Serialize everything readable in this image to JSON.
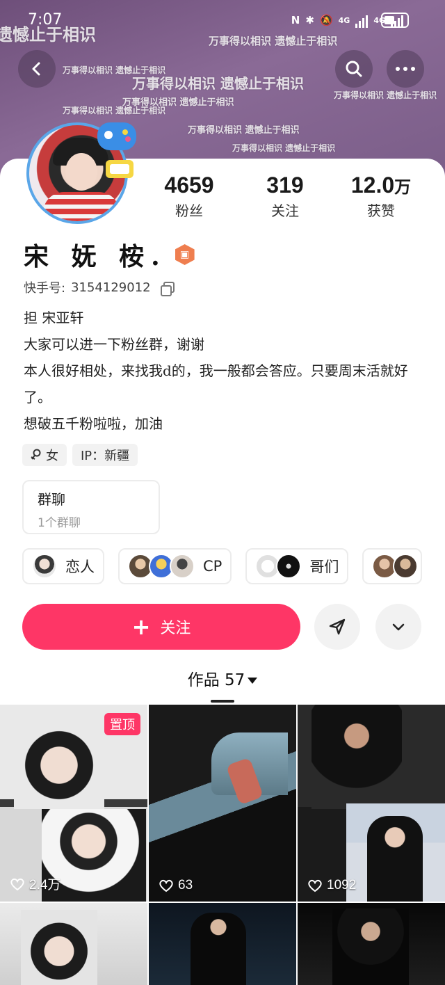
{
  "status_bar": {
    "time": "7:07",
    "network_labels": [
      "4G",
      "4G"
    ]
  },
  "banner": {
    "watermark_lines": [
      "万事得以相识 遗憾止于相识",
      "遗憾止于相识",
      "万事得以相识 遗憾止于相识",
      "万事得以相识 遗憾止于相识",
      "万事得以相识 遗憾止于相识",
      "万事得以相识 遗憾止于相识",
      "万事得以相识 遗憾止于相识",
      "万事得以相识 遗憾止于相识",
      "万事得以相识 遗憾止于相识"
    ]
  },
  "stats": [
    {
      "value": "4659",
      "label": "粉丝"
    },
    {
      "value": "319",
      "label": "关注"
    },
    {
      "value": "12.0",
      "unit": "万",
      "label": "获赞"
    }
  ],
  "profile": {
    "name": "宋 妩 桉.",
    "kuaishou_label": "快手号:",
    "kuaishou_id": "3154129012",
    "bio": [
      "担 宋亚轩",
      "大家可以进一下粉丝群，谢谢",
      "本人很好相处，来找我d的，我一般都会答应。只要周末活就好了。",
      "想破五千粉啦啦，加油"
    ],
    "tags": [
      {
        "icon": "female-icon",
        "text": "女"
      },
      {
        "text": "IP：新疆"
      }
    ]
  },
  "group_chat": {
    "title": "群聊",
    "subtitle": "1个群聊"
  },
  "relations": [
    {
      "label": "恋人"
    },
    {
      "label": "CP"
    },
    {
      "label": "哥们"
    },
    {
      "label": ""
    }
  ],
  "actions": {
    "follow": "关注"
  },
  "works": {
    "tab_label": "作品 57",
    "items": [
      {
        "likes": "2.4万",
        "pinned": "置顶"
      },
      {
        "likes": "63"
      },
      {
        "likes": "1092"
      },
      {
        "likes": ""
      },
      {
        "likes": ""
      },
      {
        "likes": ""
      }
    ]
  },
  "colors": {
    "accent": "#fe3666",
    "banner": "#7a5d88"
  }
}
